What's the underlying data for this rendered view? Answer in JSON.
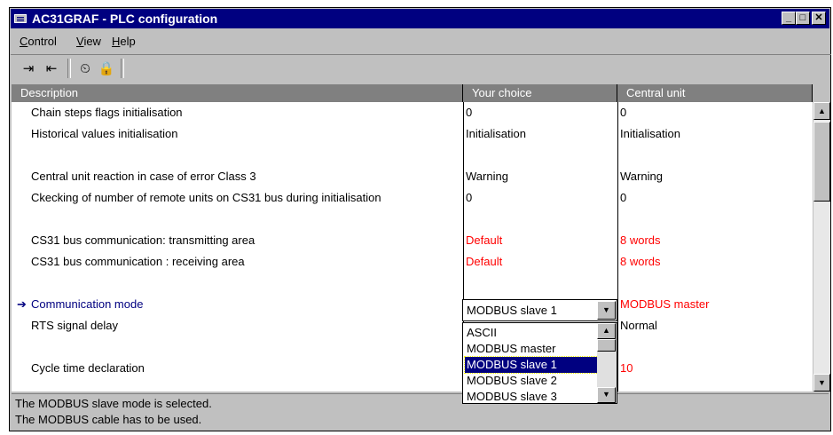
{
  "window": {
    "title": "AC31GRAF - PLC configuration",
    "controls": {
      "minimize": "_",
      "maximize": "□",
      "close": "✕"
    }
  },
  "menu": {
    "items": [
      {
        "label": "Control",
        "underline": "C",
        "rest": "ontrol"
      },
      {
        "label": "View",
        "underline": "V",
        "rest": "iew"
      },
      {
        "label": "Help",
        "underline": "H",
        "rest": "elp"
      }
    ]
  },
  "toolbar": {
    "icons": [
      "import-icon",
      "export-icon",
      "timer-icon",
      "lock-icon"
    ],
    "glyphs": [
      "⇥",
      "⇤",
      "⏲",
      "🔒"
    ]
  },
  "table": {
    "headers": [
      "Description",
      "Your choice",
      "Central unit"
    ],
    "rows": [
      {
        "description": "Chain steps flags initialisation",
        "choice": "0",
        "central": "0",
        "red": false
      },
      {
        "description": "Historical values initialisation",
        "choice": "Initialisation",
        "central": "Initialisation",
        "red": false
      },
      {
        "description": "Central unit reaction in case of error Class 3",
        "choice": "Warning",
        "central": "Warning",
        "red": false
      },
      {
        "description": "Ckecking of number of remote units on CS31 bus during initialisation",
        "choice": "0",
        "central": "0",
        "red": false
      },
      {
        "description": "CS31 bus communication: transmitting area",
        "choice": "Default",
        "central": "8 words",
        "red": true
      },
      {
        "description": "CS31 bus communication : receiving area",
        "choice": "Default",
        "central": "8 words",
        "red": true
      },
      {
        "description": "Communication mode",
        "choice": "MODBUS slave 1",
        "central": "MODBUS master",
        "red": true,
        "selected": true
      },
      {
        "description": "RTS signal delay",
        "choice": "",
        "central": "Normal",
        "red": false
      },
      {
        "description": "Cycle time declaration",
        "choice": "",
        "central": "10",
        "red": true
      }
    ]
  },
  "dropdown": {
    "selected": "MODBUS slave 1",
    "options": [
      "ASCII",
      "MODBUS master",
      "MODBUS slave 1",
      "MODBUS slave 2",
      "MODBUS slave 3"
    ]
  },
  "status": {
    "lines": [
      "The MODBUS slave mode is selected.",
      "The MODBUS cable has to be used."
    ]
  },
  "colors": {
    "titlebar": "#000080",
    "selection": "#000080",
    "warning_text": "#ff0000",
    "header_bg": "#808080"
  }
}
